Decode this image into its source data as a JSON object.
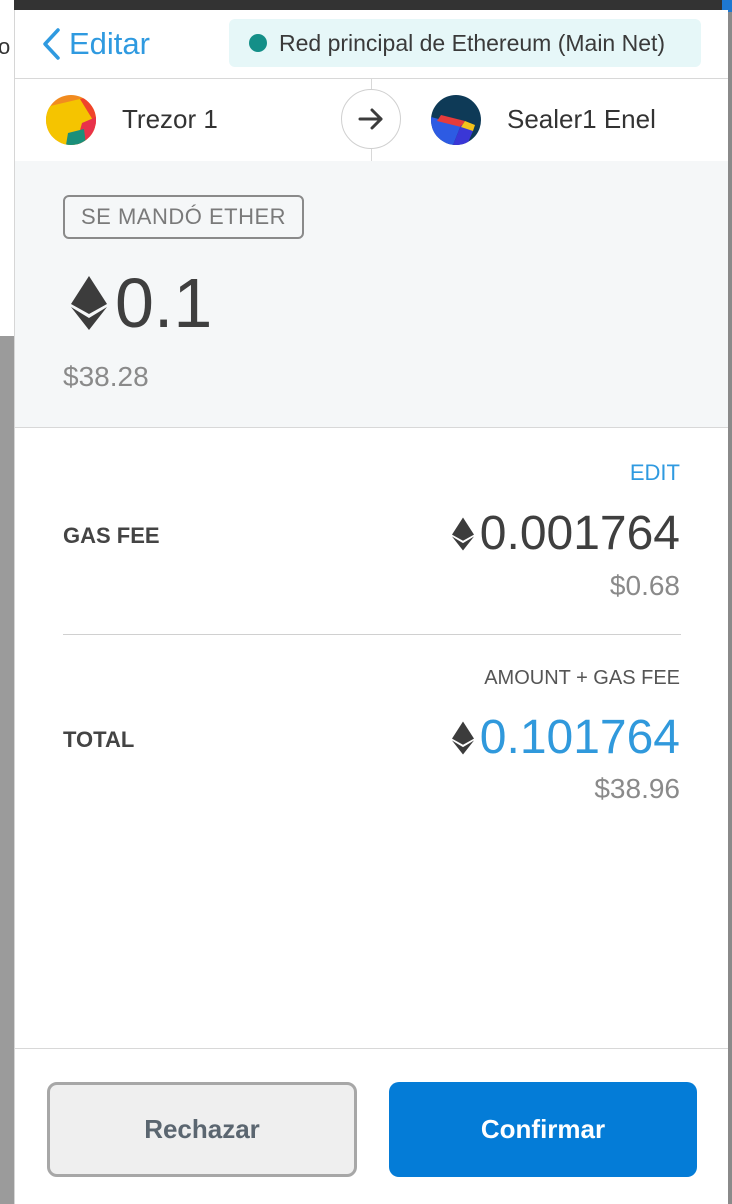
{
  "background": {
    "left_char": "o"
  },
  "header": {
    "back_label": "Editar",
    "network_label": "Red principal de Ethereum (Main Net)",
    "network_color": "#148f88"
  },
  "accounts": {
    "from_name": "Trezor 1",
    "to_name": "Sealer1 Enel",
    "arrow_icon": "arrow-right-icon"
  },
  "sent": {
    "badge": "SE MANDÓ ETHER",
    "amount": "0.1",
    "fiat": "$38.28",
    "currency_icon": "ethereum-icon"
  },
  "fees": {
    "edit_label": "EDIT",
    "gas_fee_label": "GAS FEE",
    "gas_fee_amount": "0.001764",
    "gas_fee_fiat": "$0.68",
    "amount_plus_gas_label": "AMOUNT + GAS FEE",
    "total_label": "TOTAL",
    "total_amount": "0.101764",
    "total_fiat": "$38.96"
  },
  "actions": {
    "reject_label": "Rechazar",
    "confirm_label": "Confirmar"
  },
  "colors": {
    "accent": "#2f9ae0",
    "confirm_button": "#047cd7",
    "total_value": "#3099dc"
  }
}
